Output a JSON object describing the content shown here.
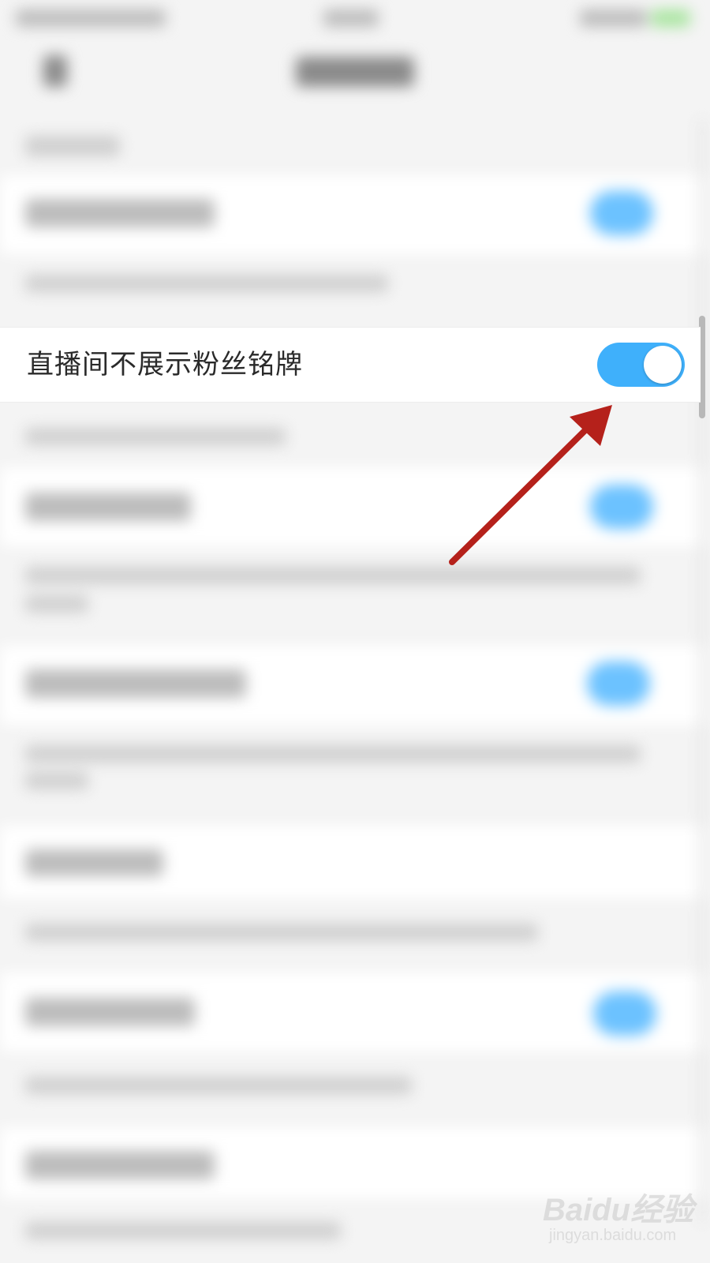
{
  "setting": {
    "label": "直播间不展示粉丝铭牌",
    "enabled": true
  },
  "colors": {
    "toggle_on": "#3fb0fb",
    "annotation_arrow": "#b5211b",
    "background": "#f4f4f4"
  },
  "watermark": {
    "logo": "Baidu经验",
    "url": "jingyan.baidu.com"
  },
  "icons": {
    "back": "back-arrow-icon",
    "annotation": "red-arrow-annotation"
  }
}
